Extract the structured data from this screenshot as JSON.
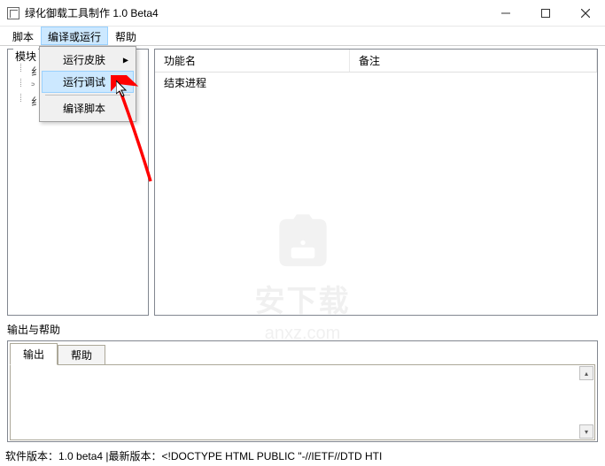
{
  "window": {
    "title": "绿化御载工具制作 1.0 Beta4"
  },
  "menubar": {
    "items": [
      "脚本",
      "编译或运行",
      "帮助"
    ],
    "active_index": 1
  },
  "dropdown": {
    "items": [
      {
        "label": "运行皮肤",
        "has_submenu": true
      },
      {
        "label": "运行调试",
        "hover": true
      },
      {
        "label": "编译脚本"
      }
    ]
  },
  "tree": {
    "label": "模块",
    "children": [
      "纟",
      "꜄",
      "纟"
    ]
  },
  "list": {
    "headers": [
      "功能名",
      "备注"
    ],
    "rows": [
      {
        "name": "结束进程",
        "note": ""
      }
    ]
  },
  "output": {
    "section_label": "输出与帮助",
    "tabs": [
      "输出",
      "帮助"
    ],
    "active_tab": 0
  },
  "statusbar": {
    "text": "软件版本：1.0 beta4 |最新版本：<!DOCTYPE HTML PUBLIC \"-//IETF//DTD HTI"
  },
  "watermark": {
    "text": "安下载",
    "url": "anxz.com"
  }
}
